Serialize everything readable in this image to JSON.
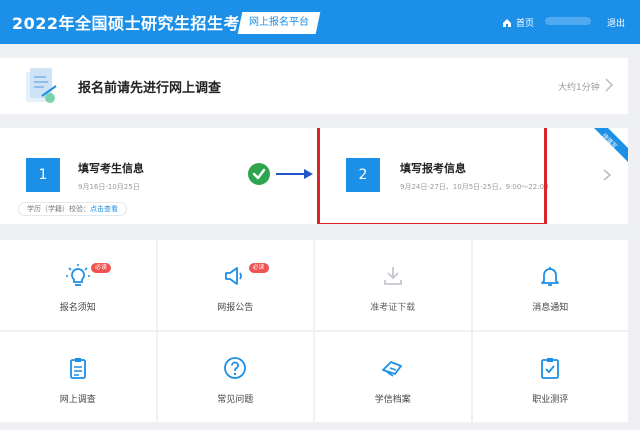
{
  "header": {
    "title": "2022年全国硕士研究生招生考试",
    "platform_badge": "网上报名平台",
    "home_label": "首页",
    "logout_label": "退出"
  },
  "survey": {
    "title": "报名前请先进行网上调查",
    "duration": "大约1分钟"
  },
  "steps": [
    {
      "number": "1",
      "title": "填写考生信息",
      "date": "9月16日-10月25日"
    },
    {
      "number": "2",
      "title": "填写报考信息",
      "date": "9月24日-27日、10月5日-25日，9:00～22:00"
    }
  ],
  "verify": {
    "label": "学历（学籍）校验：",
    "link": "点击查看"
  },
  "corner_badge": "待填写",
  "tiles": [
    {
      "label": "报名须知",
      "badge": "必读",
      "icon": "lightbulb-icon"
    },
    {
      "label": "网报公告",
      "badge": "必读",
      "icon": "megaphone-icon"
    },
    {
      "label": "准考证下载",
      "icon": "download-icon"
    },
    {
      "label": "消息通知",
      "icon": "bell-icon"
    },
    {
      "label": "网上调查",
      "icon": "clipboard-icon"
    },
    {
      "label": "常见问题",
      "icon": "question-icon"
    },
    {
      "label": "学信档案",
      "icon": "archive-icon"
    },
    {
      "label": "职业测评",
      "icon": "evaluation-icon"
    }
  ],
  "colors": {
    "brand": "#1c90e8",
    "highlight": "#d9262c",
    "success": "#2ea44f",
    "badge": "#f05252"
  }
}
